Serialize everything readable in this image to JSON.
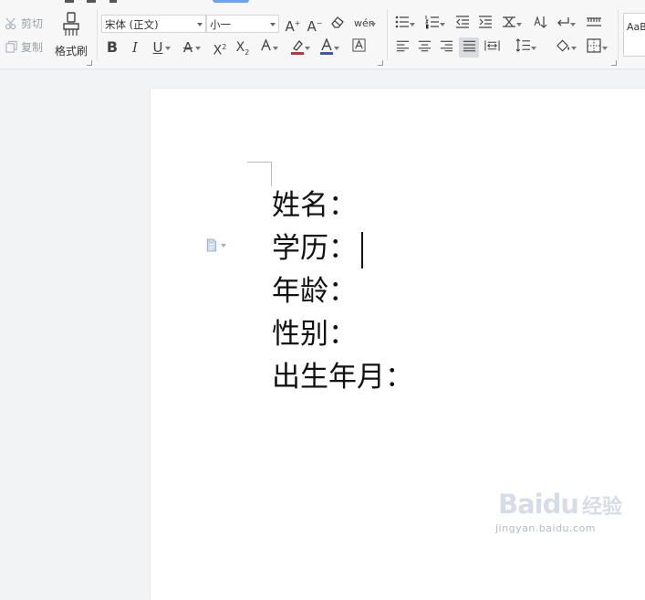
{
  "toolbar": {
    "cut_label": "剪切",
    "copy_label": "复制",
    "format_painter_label": "格式刷",
    "font_name": "宋体 (正文)",
    "font_size": "小一",
    "pinyin_icon_text": "wén",
    "style_preview_text": "AaBl",
    "accent_color": "#6aa3f0",
    "font_color": "#e8262a",
    "highlight_color": "#e8262a",
    "underline_color": "#2a5ad8"
  },
  "document": {
    "lines": [
      "姓名：",
      "学历：",
      "年龄：",
      "性别：",
      "出生年月："
    ]
  },
  "watermark": {
    "logo": "Baidu",
    "cn": "经验",
    "url": "jingyan.baidu.com"
  }
}
